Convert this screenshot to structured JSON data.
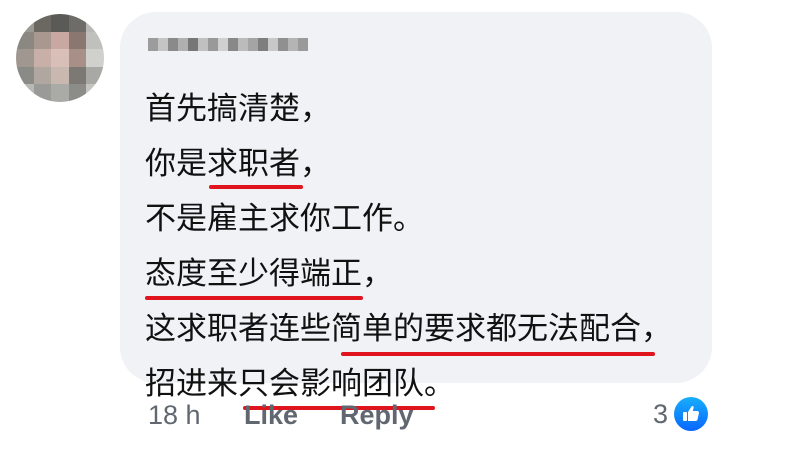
{
  "comment": {
    "lines": [
      "首先搞清楚，",
      "你是求职者，",
      "不是雇主求你工作。",
      "态度至少得端正，",
      "这求职者连些简单的要求都无法配合，",
      "招进来只会影响团队。"
    ],
    "underline_color": "#e0141c"
  },
  "actions": {
    "time": "18 h",
    "like": "Like",
    "reply": "Reply"
  },
  "reactions": {
    "count": "3",
    "icon": "thumbs-up-icon",
    "color": "#0866ff"
  },
  "colors": {
    "bubble": "#f0f2f5",
    "meta_text": "#606770"
  }
}
